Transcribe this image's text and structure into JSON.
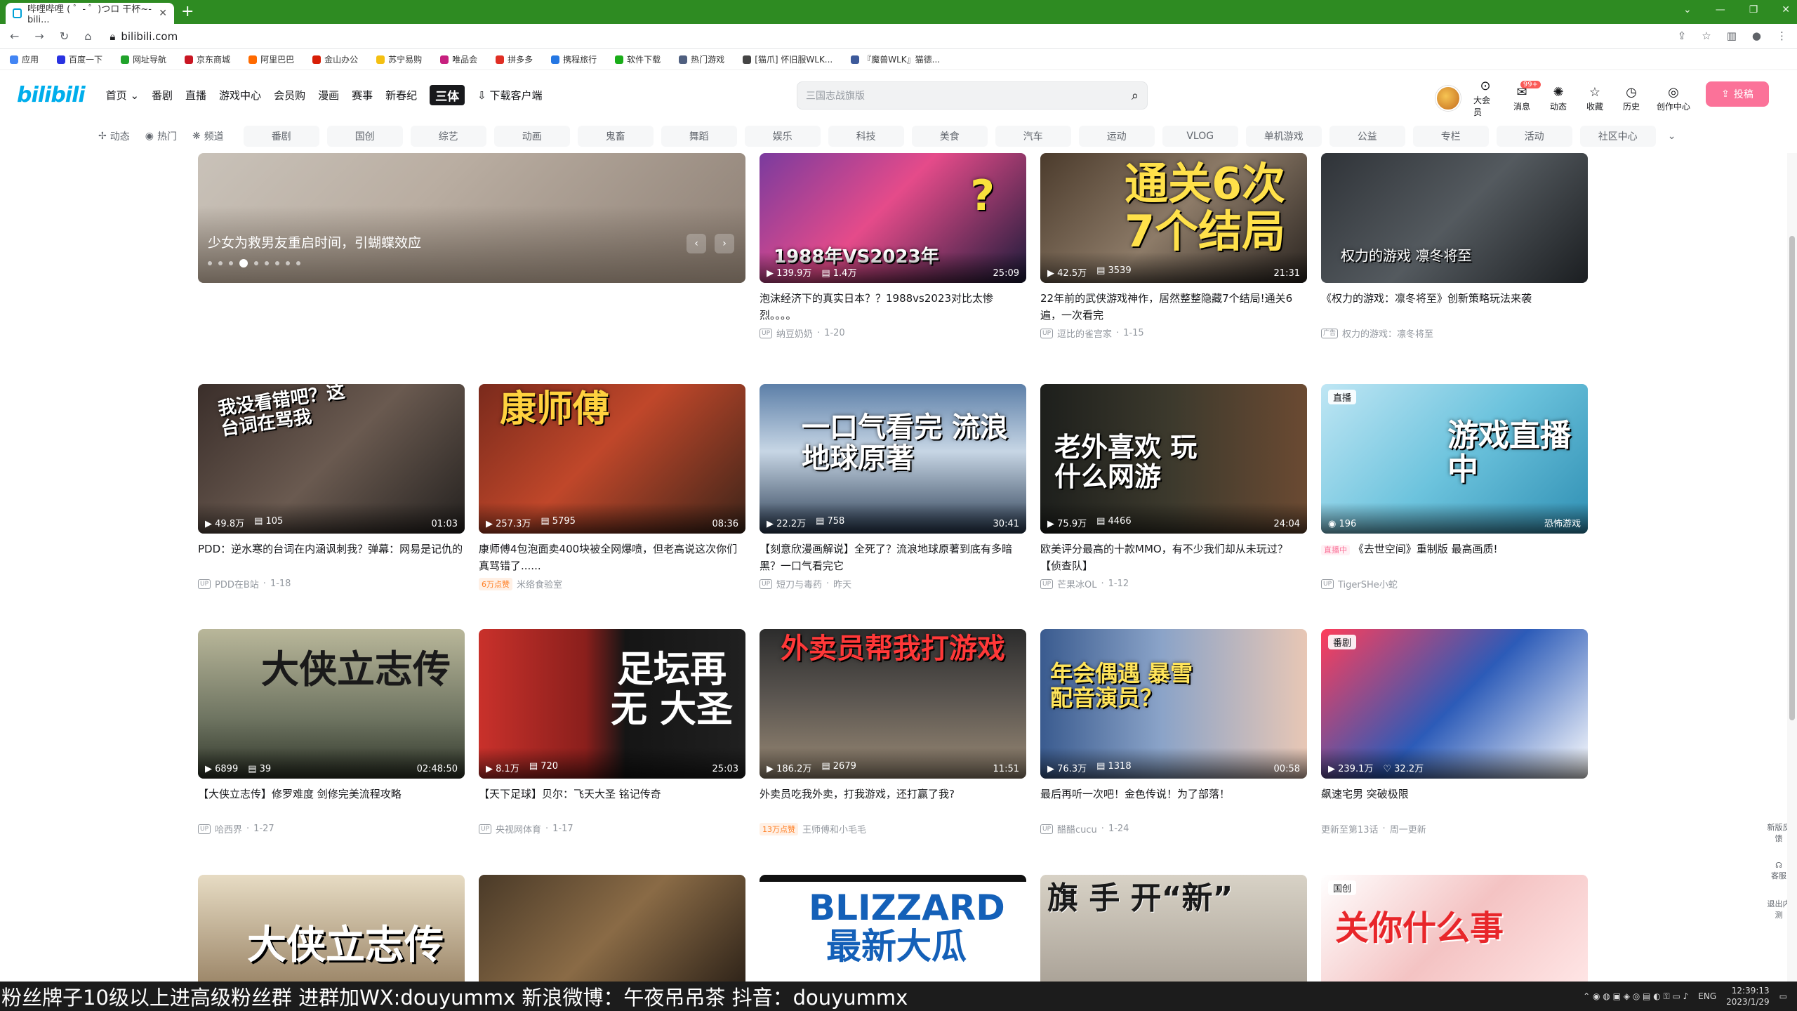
{
  "browser": {
    "tab_title": "哔哩哔哩 ( ゜- ゜)つロ 干杯~-bili...",
    "url": "bilibili.com",
    "bookmarks": [
      "应用",
      "百度一下",
      "网址导航",
      "京东商城",
      "阿里巴巴",
      "金山办公",
      "苏宁易购",
      "唯品会",
      "拼多多",
      "携程旅行",
      "软件下载",
      "热门游戏",
      "[猫爪] 怀旧服WLK...",
      "『魔兽WLK』猫德..."
    ]
  },
  "header": {
    "logo": "bilibili",
    "nav": [
      "首页",
      "番剧",
      "直播",
      "游戏中心",
      "会员购",
      "漫画",
      "赛事",
      "新春纪"
    ],
    "nav_special": "三体",
    "download": "下载客户端",
    "search_placeholder": "三国志战旗版",
    "icons": [
      {
        "label": "大会员",
        "glyph": "⊙"
      },
      {
        "label": "消息",
        "glyph": "✉",
        "badge": "99+"
      },
      {
        "label": "动态",
        "glyph": "✺"
      },
      {
        "label": "收藏",
        "glyph": "☆"
      },
      {
        "label": "历史",
        "glyph": "◷"
      },
      {
        "label": "创作中心",
        "glyph": "◎"
      }
    ],
    "upload": "投稿"
  },
  "channels": {
    "quick": [
      {
        "label": "动态",
        "glyph": "✢"
      },
      {
        "label": "热门",
        "glyph": "◉"
      },
      {
        "label": "频道",
        "glyph": "❋"
      }
    ],
    "categories": [
      "番剧",
      "国创",
      "综艺",
      "动画",
      "鬼畜",
      "舞蹈",
      "娱乐",
      "科技",
      "美食",
      "汽车",
      "运动",
      "VLOG",
      "单机游戏",
      "公益",
      "专栏",
      "活动",
      "社区中心"
    ]
  },
  "carousel": {
    "title": "少女为救男友重启时间，引蝴蝶效应"
  },
  "row1": [
    {
      "title": "泡沫经济下的真实日本？？1988vs2023对比太惨烈。。。。",
      "author": "纳豆奶奶",
      "date": "1-20",
      "views": "139.9万",
      "danmaku": "1.4万",
      "duration": "25:09",
      "overlay": "1988年VS2023年"
    },
    {
      "title": "22年前的武侠游戏神作，居然整整隐藏7个结局!通关6遍，一次看完",
      "author": "逗比的雀宫家",
      "date": "1-15",
      "views": "42.5万",
      "danmaku": "3539",
      "duration": "21:31",
      "overlay": "通关6次 7个结局"
    },
    {
      "title": "《权力的游戏：凛冬将至》创新策略玩法来袭",
      "author": "权力的游戏：凛冬将至",
      "date": "",
      "views": "",
      "danmaku": "",
      "duration": "",
      "overlay": "权力的游戏 凛冬将至",
      "ad": "广告"
    }
  ],
  "row2": [
    {
      "title": "PDD：逆水寒的台词在内涵讽刺我？弹幕：网易是记仇的",
      "author": "PDD在B站",
      "date": "1-18",
      "views": "49.8万",
      "danmaku": "105",
      "duration": "01:03",
      "overlay": "我没看错吧？这台词在骂我"
    },
    {
      "title": "康师傅4包泡面卖400块被全网爆喷，但老高说这次你们真骂错了......",
      "author": "米络食验室",
      "date": "",
      "views": "257.3万",
      "danmaku": "5795",
      "duration": "08:36",
      "overlay": "康师傅",
      "hot": "6万点赞"
    },
    {
      "title": "【刻意欣漫画解说】全死了？流浪地球原著到底有多暗黑？一口气看完它",
      "author": "短刀与毒药",
      "date": "昨天",
      "views": "22.2万",
      "danmaku": "758",
      "duration": "30:41",
      "overlay": "一口气看完 流浪地球原著"
    },
    {
      "title": "欧美评分最高的十款MMO，有不少我们却从未玩过？【侦查队】",
      "author": "芒果冰OL",
      "date": "1-12",
      "views": "75.9万",
      "danmaku": "4466",
      "duration": "24:04",
      "overlay": "老外喜欢 玩什么网游"
    },
    {
      "title": "《去世空间》重制版 最高画质!",
      "author": "TigerSHe小蛇",
      "date": "",
      "views": "196",
      "danmaku": "",
      "duration": "恐怖游戏",
      "overlay": "游戏直播中",
      "tag": "直播",
      "live": "直播中"
    }
  ],
  "row3": [
    {
      "title": "【大侠立志传】修罗难度 剑修完美流程攻略",
      "author": "哈西界",
      "date": "1-27",
      "views": "6899",
      "danmaku": "39",
      "duration": "02:48:50",
      "overlay": "大侠立志传"
    },
    {
      "title": "【天下足球】贝尔：飞天大圣 铭记传奇",
      "author": "央视网体育",
      "date": "1-17",
      "views": "8.1万",
      "danmaku": "720",
      "duration": "25:03",
      "overlay": "足坛再无 大圣"
    },
    {
      "title": "外卖员吃我外卖，打我游戏，还打赢了我?",
      "author": "王师傅和小毛毛",
      "date": "",
      "views": "186.2万",
      "danmaku": "2679",
      "duration": "11:51",
      "overlay": "外卖员帮我打游戏",
      "hot": "13万点赞"
    },
    {
      "title": "最后再听一次吧！金色传说！为了部落！",
      "author": "醋醋cucu",
      "date": "1-24",
      "views": "76.3万",
      "danmaku": "1318",
      "duration": "00:58",
      "overlay": "年会偶遇 暴雪配音演员？"
    },
    {
      "title": "飙速宅男 突破极限",
      "author": "更新至第13话",
      "date": "周一更新",
      "views": "239.1万",
      "danmaku": "32.2万",
      "duration": "",
      "overlay": "",
      "tag": "番剧"
    }
  ],
  "row4": [
    {
      "overlay": "大侠立志传"
    },
    {
      "overlay": ""
    },
    {
      "overlay": "BLIZZARD 最新大瓜"
    },
    {
      "overlay": "旗 手 开“新”"
    },
    {
      "overlay": "关你什么事",
      "tag": "国创"
    }
  ],
  "float": [
    "新版反馈",
    "客服",
    "退出内测"
  ],
  "ticker": "粉丝牌子10级以上进高级粉丝群  进群加WX:douyummx 新浪微博：午夜吊吊茶    抖音：douyummx",
  "tray": {
    "lang": "ENG",
    "time": "12:39:13",
    "date": "2023/1/29"
  }
}
